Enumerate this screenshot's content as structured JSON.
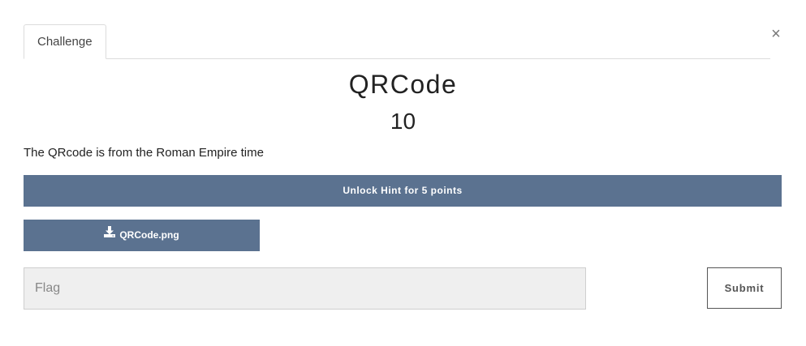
{
  "tabs": [
    {
      "label": "Challenge",
      "active": true
    }
  ],
  "close_glyph": "×",
  "challenge": {
    "name": "QRCode",
    "value": "10",
    "description": "The QRcode is from the Roman Empire time"
  },
  "hint": {
    "label": "Unlock Hint for 5 points"
  },
  "file": {
    "icon": "download-icon",
    "label": "QRCode.png"
  },
  "submission": {
    "placeholder": "Flag",
    "value": "",
    "submit_label": "Submit"
  },
  "colors": {
    "button_bg": "#5b7290",
    "button_text": "#ffffff",
    "input_bg": "#efefef"
  }
}
